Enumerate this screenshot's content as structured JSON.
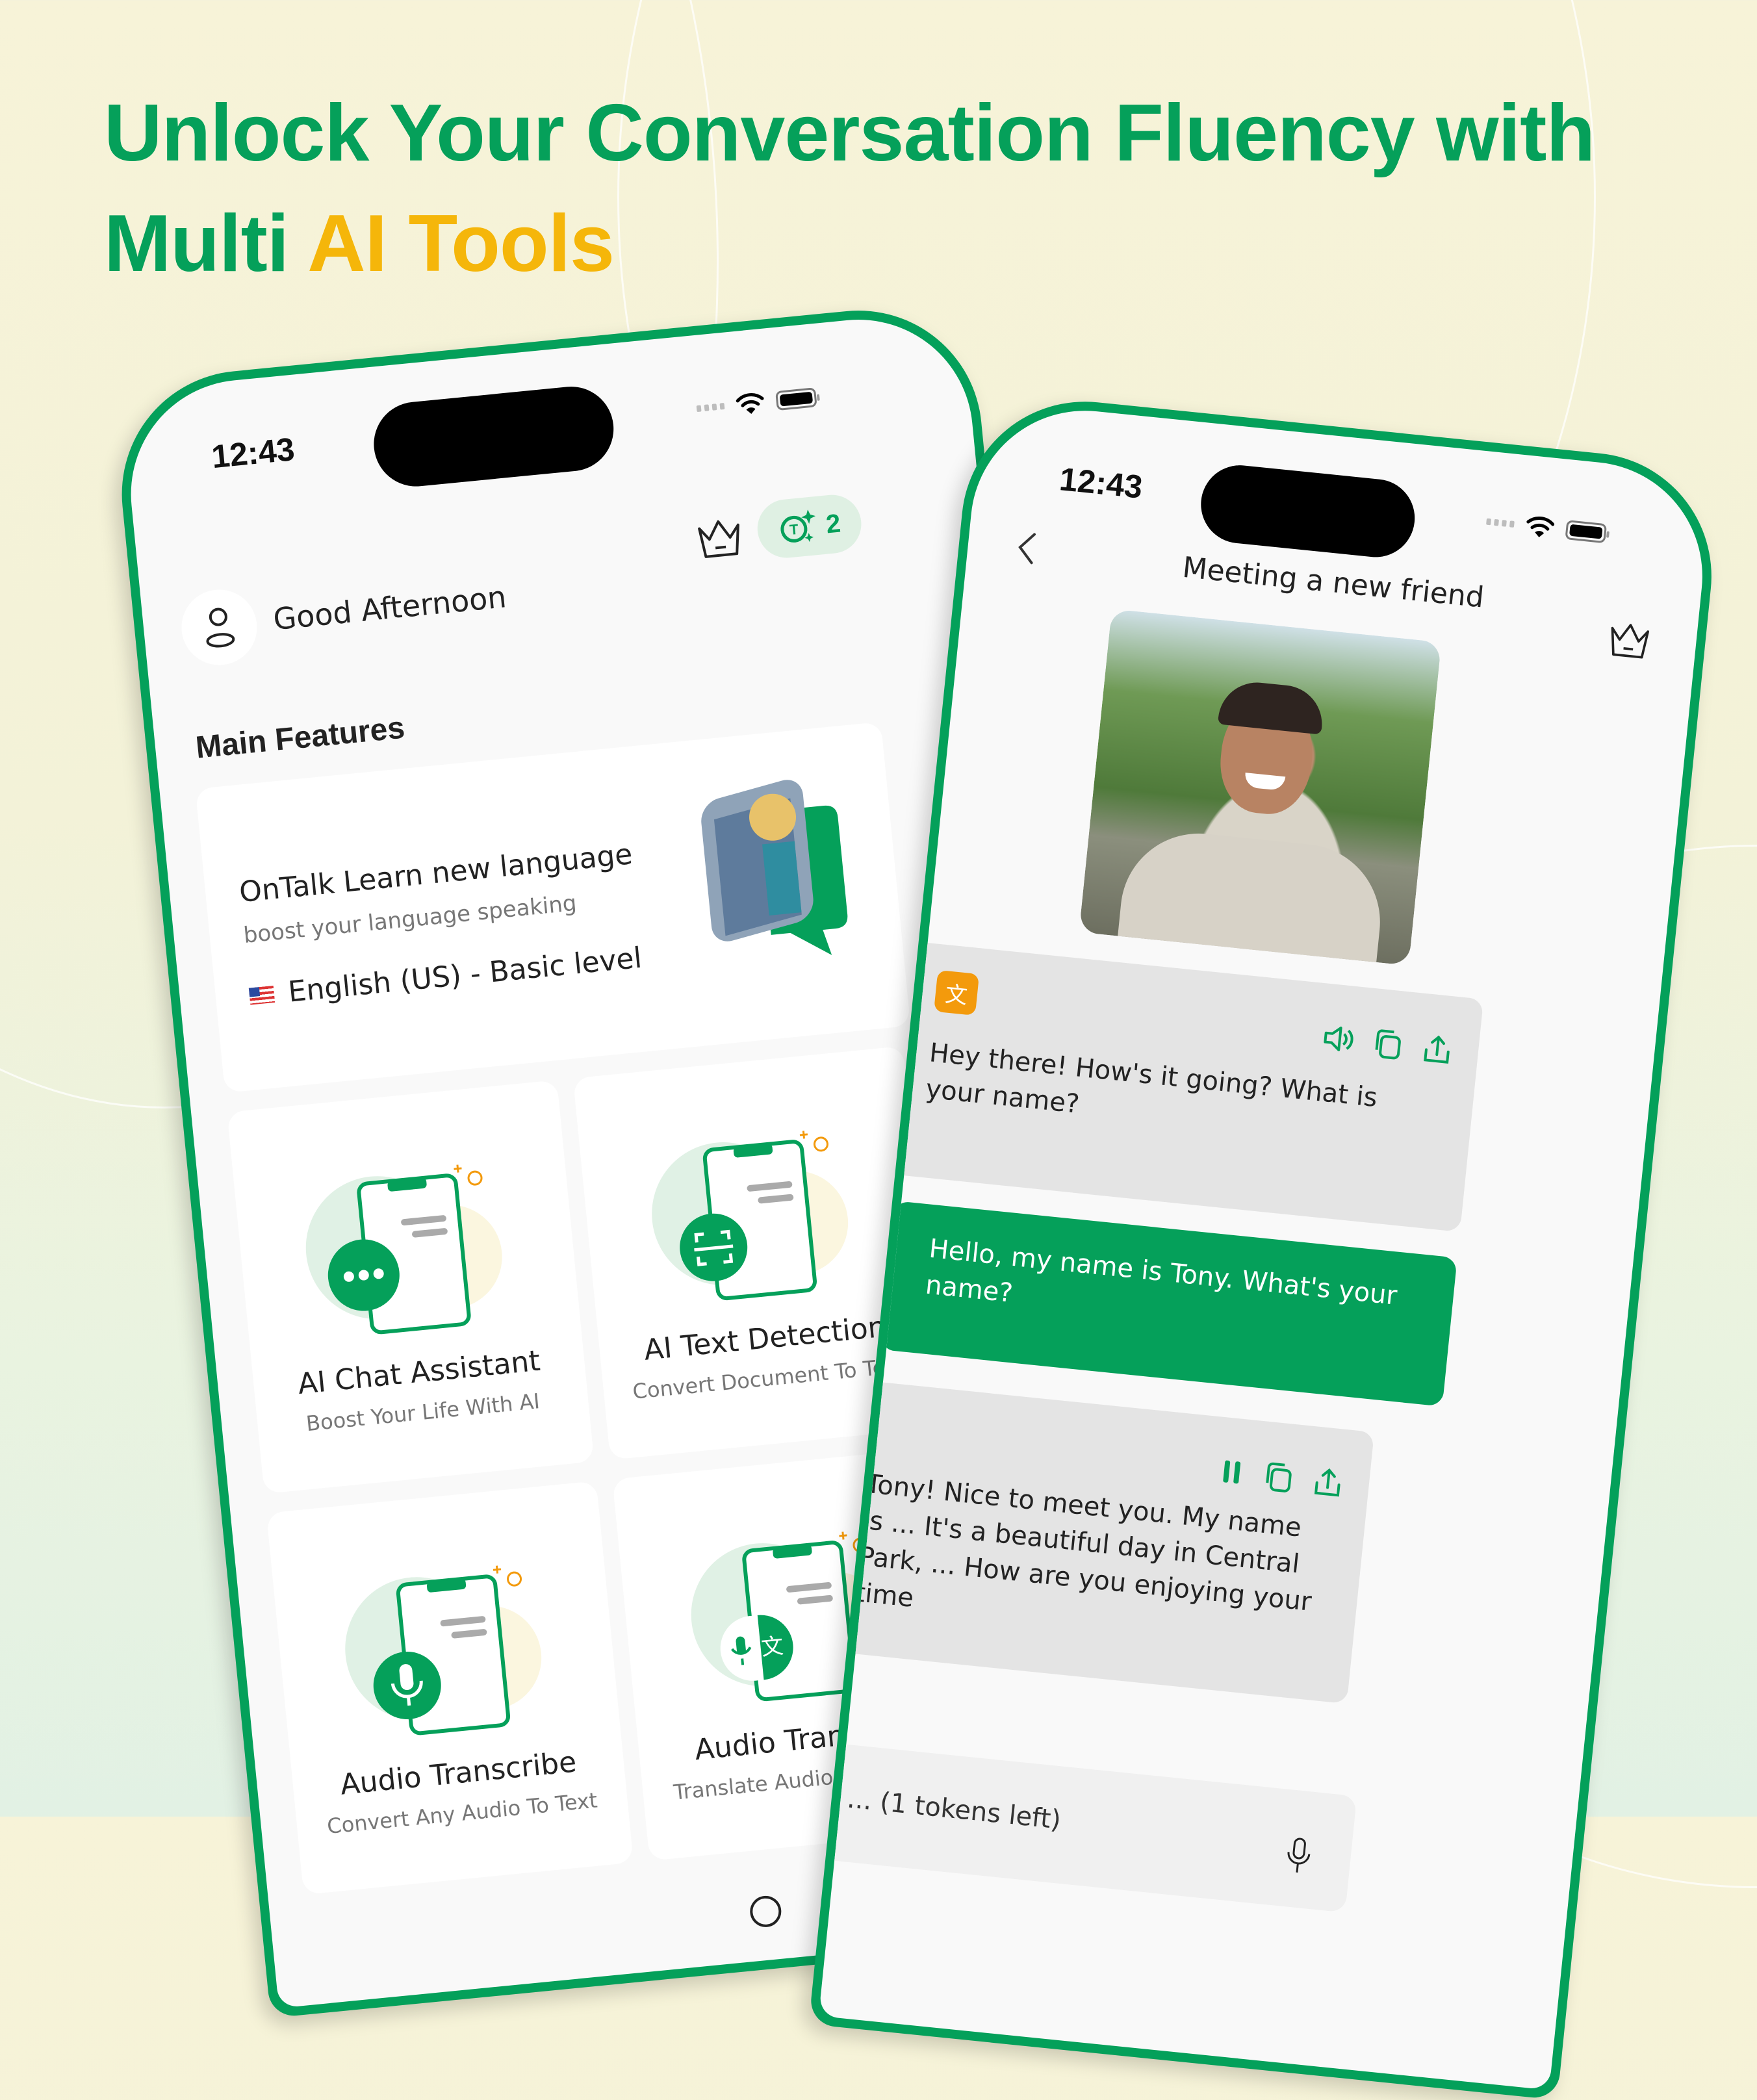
{
  "headline": {
    "line1": "Unlock Your Conversation Fluency with",
    "line2_prefix": "Multi ",
    "line2_accent": "AI Tools"
  },
  "colors": {
    "brand_green": "#05a05a",
    "accent_yellow": "#f5b60a",
    "translate_orange": "#f39a0c"
  },
  "left_phone": {
    "status": {
      "time": "12:43"
    },
    "header": {
      "greeting": "Good Afternoon",
      "avatar_icon": "user-icon",
      "premium_icon": "crown-icon",
      "token_icon": "token-sparkle-icon",
      "token_count": "2"
    },
    "section_title": "Main Features",
    "hero_card": {
      "title": "OnTalk Learn new language",
      "subtitle": "boost your language speaking",
      "language": "English (US) - Basic level",
      "flag_icon": "us-flag-icon"
    },
    "features": [
      {
        "title": "AI Chat Assistant",
        "subtitle": "Boost Your Life With AI",
        "icon": "chat-bubble-icon"
      },
      {
        "title": "AI Text Detection",
        "subtitle": "Convert Document To Text",
        "icon": "scan-text-icon"
      },
      {
        "title": "Audio Transcribe",
        "subtitle": "Convert Any Audio To Text",
        "icon": "microphone-icon"
      },
      {
        "title": "Audio Translate",
        "subtitle": "Translate Audio To English",
        "icon": "voice-translate-icon"
      }
    ]
  },
  "right_phone": {
    "status": {
      "time": "12:43"
    },
    "header": {
      "title": "Meeting a new friend",
      "back_icon": "chevron-left-icon",
      "premium_icon": "crown-icon"
    },
    "messages": [
      {
        "role": "ai",
        "text": "Hey there! How's it going? What is your name?",
        "actions": [
          "speaker-icon",
          "copy-icon",
          "share-icon"
        ]
      },
      {
        "role": "user",
        "text": "Hello, my name is Tony. What's your name?"
      },
      {
        "role": "ai",
        "text": "Tony! Nice to meet you. My name is ... It's a beautiful day in Central Park, ... How are you enjoying your time",
        "actions": [
          "pause-icon",
          "copy-icon",
          "share-icon"
        ]
      }
    ],
    "input": {
      "placeholder": "... (1 tokens left)",
      "mic_icon": "microphone-icon"
    }
  }
}
